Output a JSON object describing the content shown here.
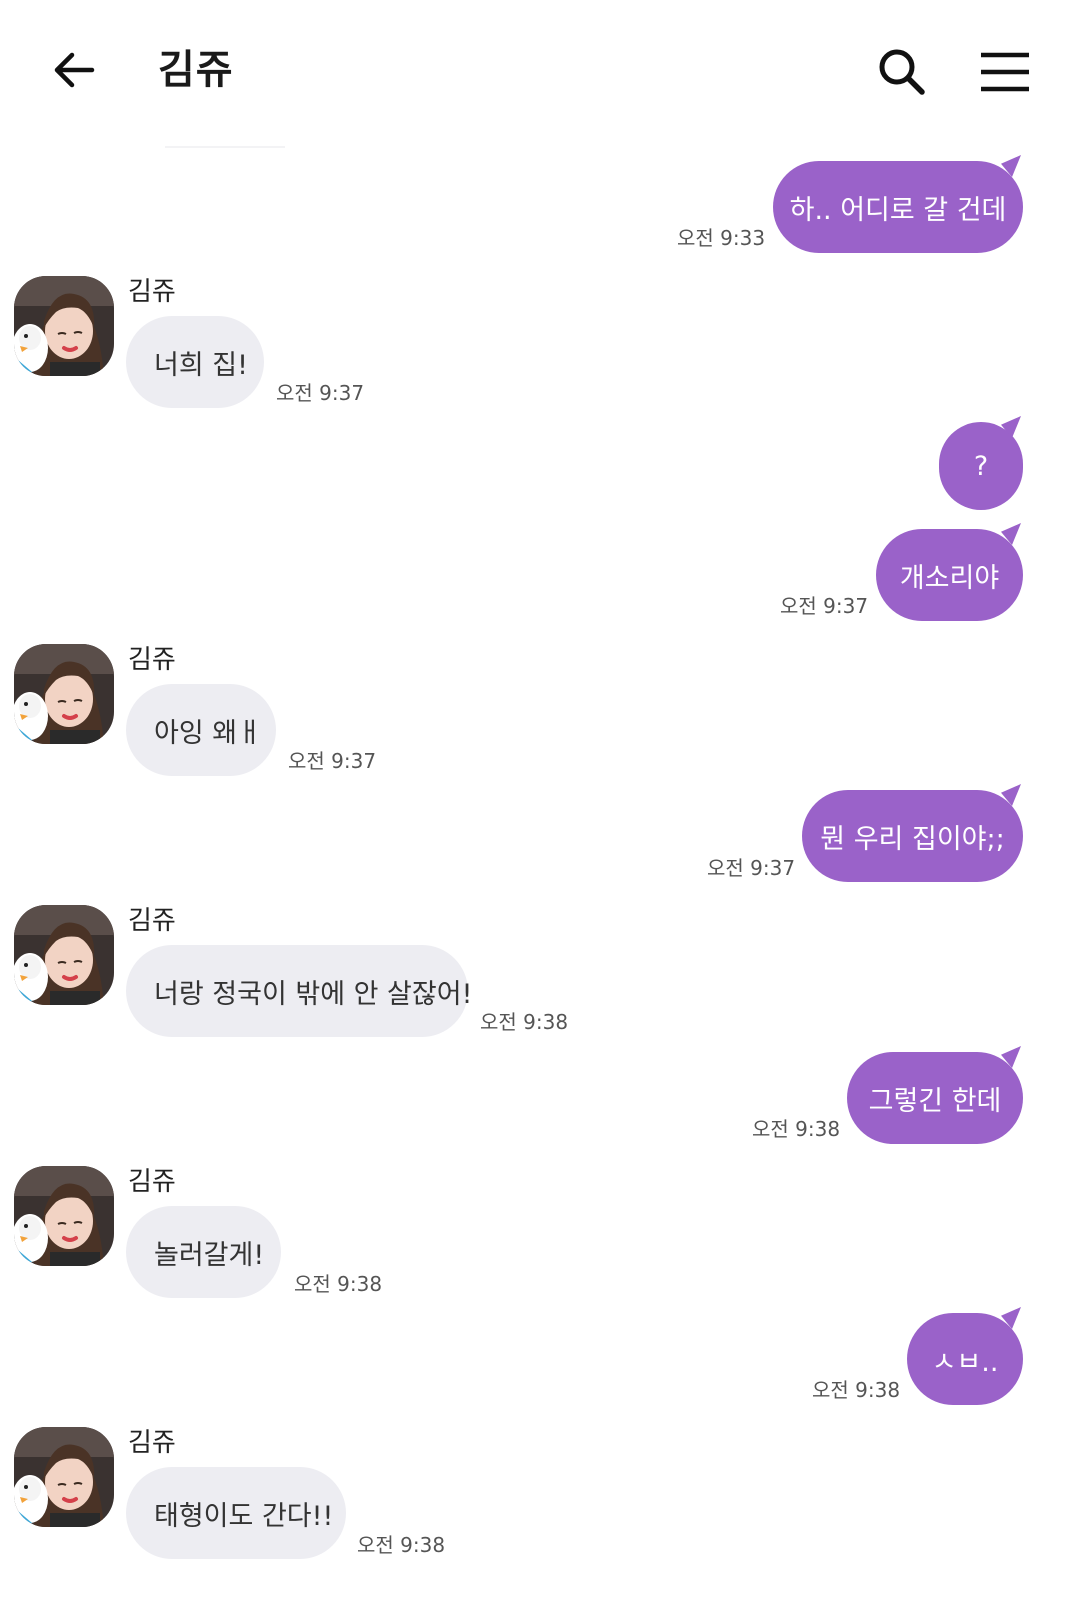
{
  "header": {
    "title": "김쥬",
    "back_icon": "arrow-left-icon",
    "search_icon": "search-icon",
    "menu_icon": "hamburger-menu-icon"
  },
  "colors": {
    "outgoing_bubble": "#9a62c9",
    "incoming_bubble": "#ededf2",
    "background": "#ffffff"
  },
  "messages": [
    {
      "direction": "out",
      "text": "하.. 어디로 갈 건데",
      "time": "오전 9:33"
    },
    {
      "direction": "in",
      "sender": "김쥬",
      "text": "너희 집!",
      "time": "오전 9:37"
    },
    {
      "direction": "out",
      "text": "?",
      "time": ""
    },
    {
      "direction": "out",
      "text": "개소리야",
      "time": "오전 9:37"
    },
    {
      "direction": "in",
      "sender": "김쥬",
      "text": "아잉 왜ㅐ",
      "time": "오전 9:37"
    },
    {
      "direction": "out",
      "text": "뭔 우리 집이야;;",
      "time": "오전 9:37"
    },
    {
      "direction": "in",
      "sender": "김쥬",
      "text": "너랑 정국이 밖에 안 살잖어!",
      "time": "오전 9:38"
    },
    {
      "direction": "out",
      "text": "그렇긴 한데",
      "time": "오전 9:38"
    },
    {
      "direction": "in",
      "sender": "김쥬",
      "text": "놀러갈게!",
      "time": "오전 9:38"
    },
    {
      "direction": "out",
      "text": "ㅅㅂ..",
      "time": "오전 9:38"
    },
    {
      "direction": "in",
      "sender": "김쥬",
      "text": "태형이도 간다!!",
      "time": "오전 9:38"
    }
  ]
}
